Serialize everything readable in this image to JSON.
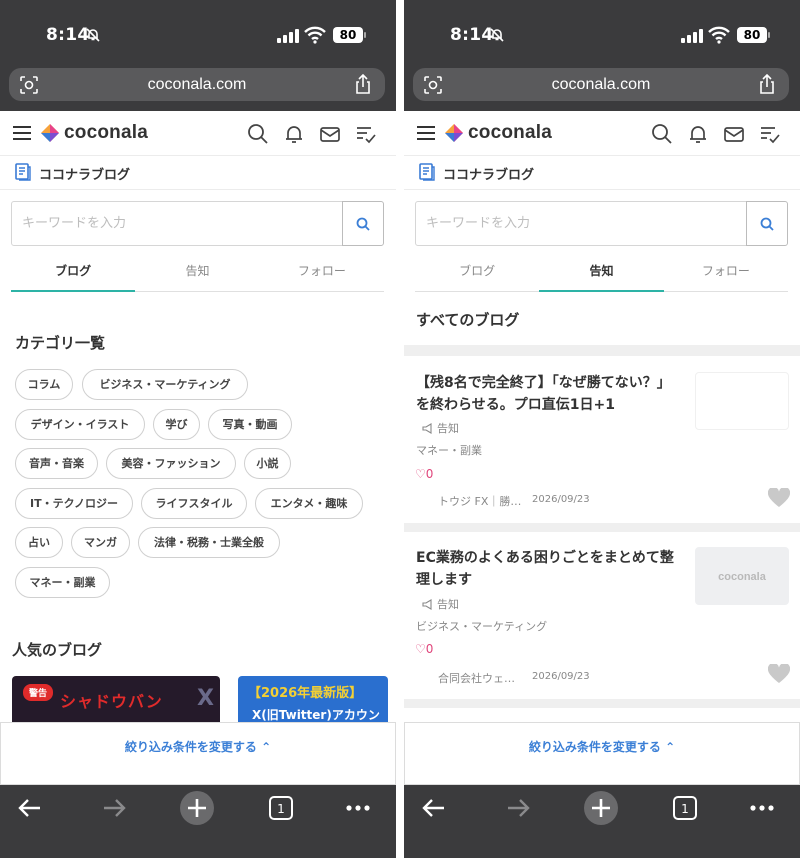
{
  "status": {
    "time": "8:14",
    "battery": "80"
  },
  "browser": {
    "url": "coconala.com"
  },
  "site": {
    "logo_text": "coconala",
    "blog_title": "ココナラブログ"
  },
  "search": {
    "placeholder": "キーワードを入力"
  },
  "tabs": [
    "ブログ",
    "告知",
    "フォロー"
  ],
  "left": {
    "categories_heading": "カテゴリ一覧",
    "categories": [
      "コラム",
      "ビジネス・マーケティング",
      "デザイン・イラスト",
      "学び",
      "写真・動画",
      "音声・音楽",
      "美容・ファッション",
      "小説",
      "IT・テクノロジー",
      "ライフスタイル",
      "エンタメ・趣味",
      "占い",
      "マンガ",
      "法律・税務・士業全般",
      "マネー・副業"
    ],
    "popular_heading": "人気のブログ",
    "popular_cards": [
      {
        "badge": "警告",
        "text": "シャドウバン",
        "mark": "X"
      },
      {
        "text": "【2026年最新版】",
        "text2": "X(旧Twitter)アカウン"
      }
    ]
  },
  "right": {
    "heading": "すべてのブログ",
    "articles": [
      {
        "title": "【残8名で完全終了】「なぜ勝てない？」を終わらせる。プロ直伝1日+1",
        "notice": "告知",
        "category": "マネー・副業",
        "likes": "0",
        "author": "トウジ FX｜勝…",
        "date": "2026/09/23",
        "thumb_text": ""
      },
      {
        "title": "EC業務のよくある困りごとをまとめて整理します",
        "notice": "告知",
        "category": "ビジネス・マーケティング",
        "likes": "0",
        "author": "合同会社ウェ…",
        "date": "2026/09/23",
        "thumb_text": "coconala"
      }
    ]
  },
  "filter": {
    "label": "絞り込み条件を変更する"
  },
  "colors": {
    "accent_tab": "#2db3a6",
    "link_blue": "#3b7fd6",
    "like_pink": "#e0457b",
    "browser_chrome": "#3b3b3d"
  }
}
